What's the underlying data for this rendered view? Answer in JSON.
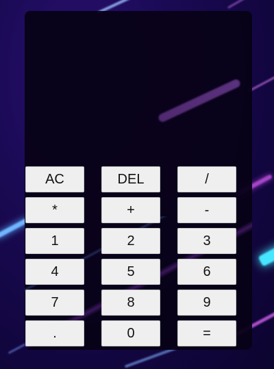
{
  "display": {
    "value": ""
  },
  "keys": {
    "ac": "AC",
    "del": "DEL",
    "divide": "/",
    "multiply": "*",
    "plus": "+",
    "minus": "-",
    "one": "1",
    "two": "2",
    "three": "3",
    "four": "4",
    "five": "5",
    "six": "6",
    "seven": "7",
    "eight": "8",
    "nine": "9",
    "dot": ".",
    "zero": "0",
    "equals": "="
  },
  "colors": {
    "key_background": "#efefef",
    "calculator_background": "#080218",
    "page_background": "#1a0a55"
  }
}
